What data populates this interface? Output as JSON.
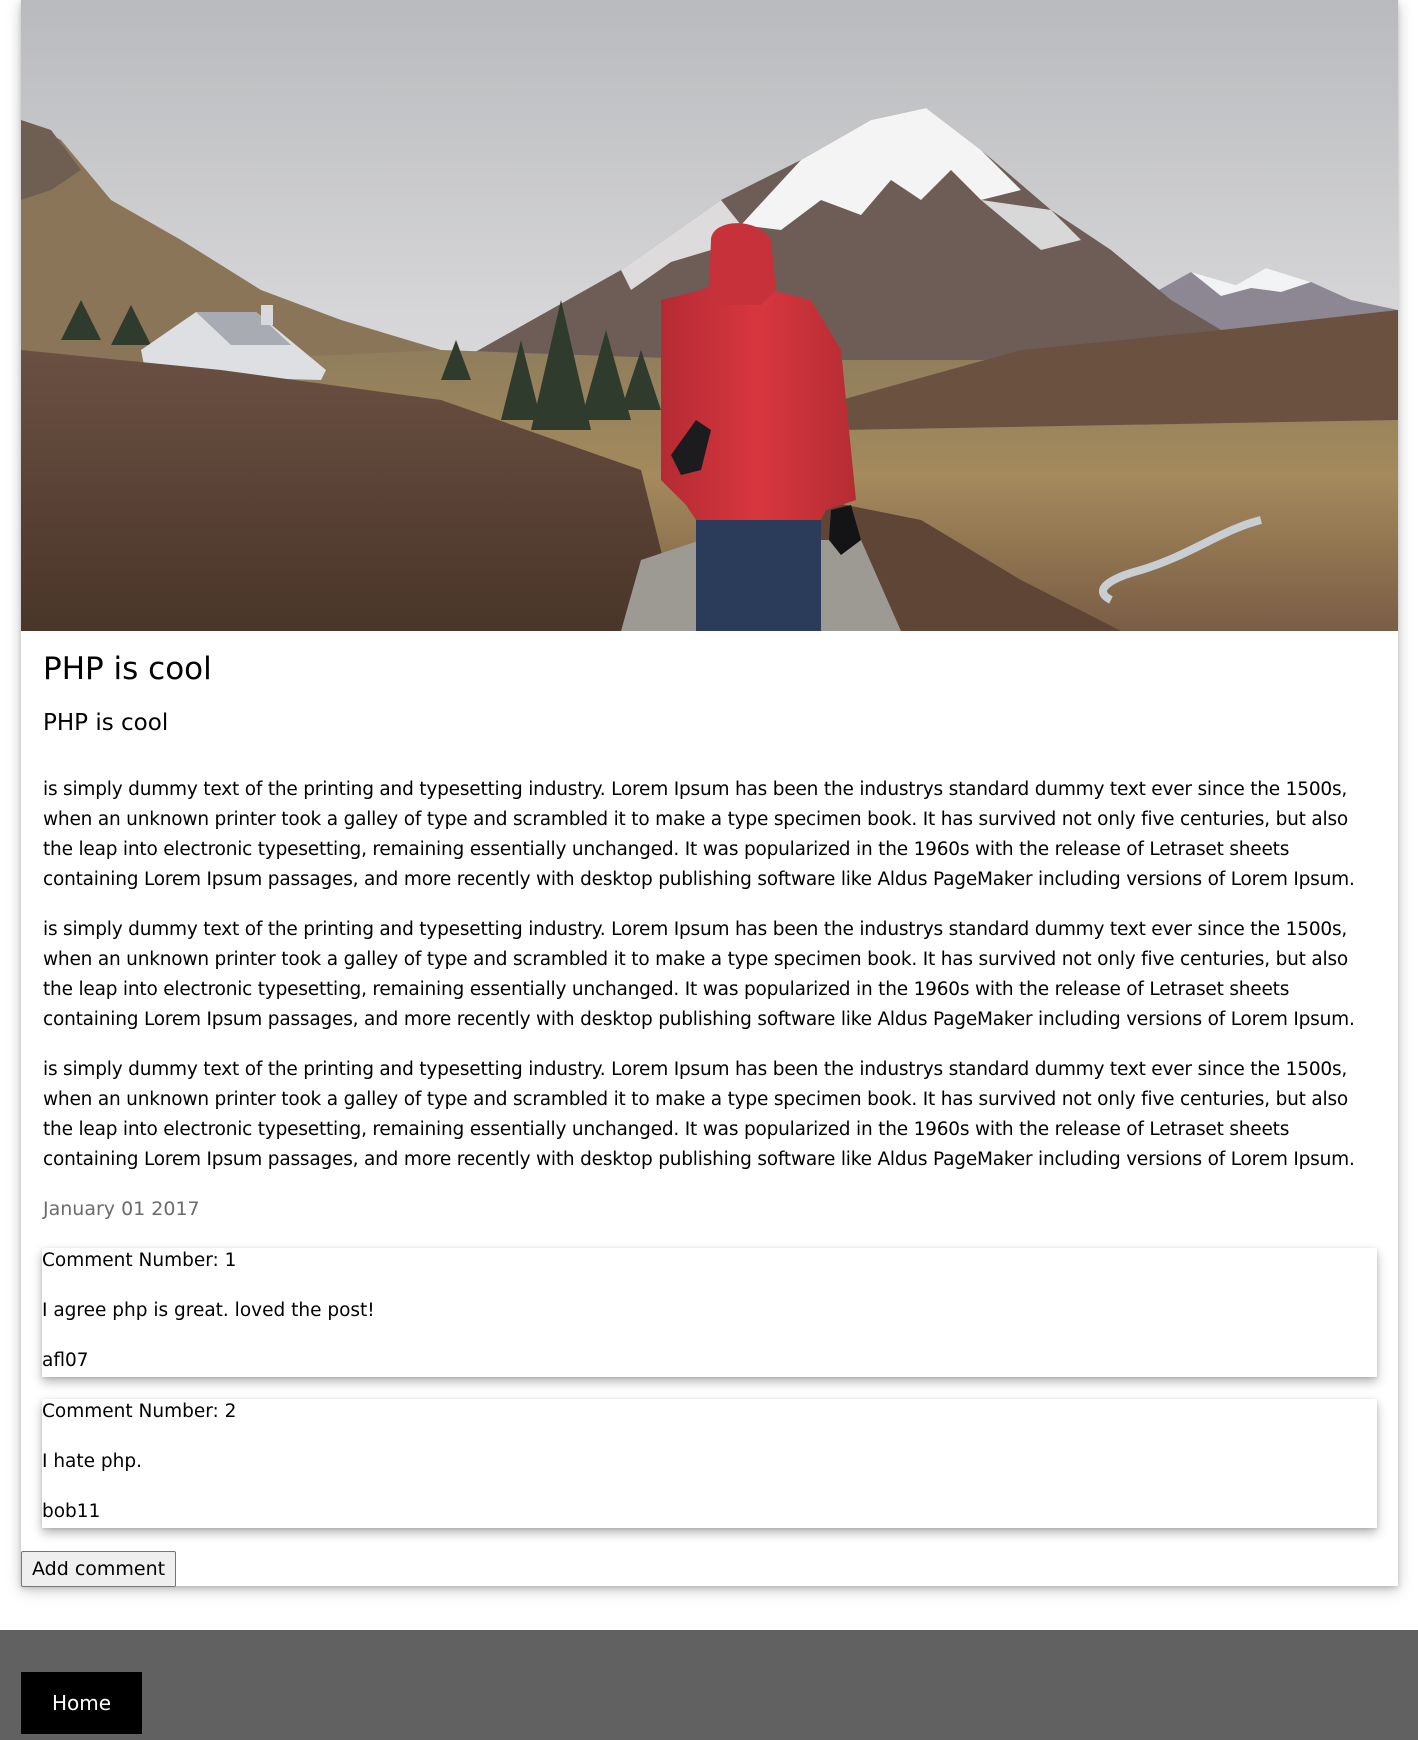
{
  "post": {
    "hero_image": "photo of a hiker in a red hooded jacket walking on a trail toward a snow-capped mountain",
    "title": "PHP is cool",
    "subtitle": "PHP is cool",
    "paragraphs": [
      "is simply dummy text of the printing and typesetting industry. Lorem Ipsum has been the industrys standard dummy text ever since the 1500s, when an unknown printer took a galley of type and scrambled it to make a type specimen book. It has survived not only five centuries, but also the leap into electronic typesetting, remaining essentially unchanged. It was popularized in the 1960s with the release of Letraset sheets containing Lorem Ipsum passages, and more recently with desktop publishing software like Aldus PageMaker including versions of Lorem Ipsum.",
      "is simply dummy text of the printing and typesetting industry. Lorem Ipsum has been the industrys standard dummy text ever since the 1500s, when an unknown printer took a galley of type and scrambled it to make a type specimen book. It has survived not only five centuries, but also the leap into electronic typesetting, remaining essentially unchanged. It was popularized in the 1960s with the release of Letraset sheets containing Lorem Ipsum passages, and more recently with desktop publishing software like Aldus PageMaker including versions of Lorem Ipsum.",
      "is simply dummy text of the printing and typesetting industry. Lorem Ipsum has been the industrys standard dummy text ever since the 1500s, when an unknown printer took a galley of type and scrambled it to make a type specimen book. It has survived not only five centuries, but also the leap into electronic typesetting, remaining essentially unchanged. It was popularized in the 1960s with the release of Letraset sheets containing Lorem Ipsum passages, and more recently with desktop publishing software like Aldus PageMaker including versions of Lorem Ipsum."
    ],
    "date": "January 01 2017"
  },
  "comments": [
    {
      "number_label": "Comment Number: 1",
      "text": "I agree php is great. loved the post!",
      "author": "afl07"
    },
    {
      "number_label": "Comment Number: 2",
      "text": "I hate php.",
      "author": "bob11"
    }
  ],
  "actions": {
    "add_comment_label": "Add comment"
  },
  "footer": {
    "home_label": "Home"
  },
  "colors": {
    "footer_bg": "#616161",
    "home_button_bg": "#000000",
    "date_text": "#6b6b6b",
    "jacket_red": "#d8363f"
  }
}
